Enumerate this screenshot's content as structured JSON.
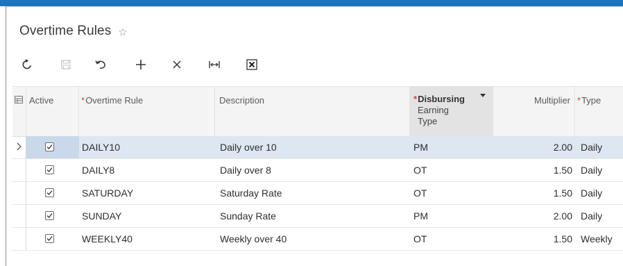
{
  "page": {
    "title": "Overtime Rules"
  },
  "toolbar": {
    "buttons": [
      {
        "icon": "refresh-icon",
        "enabled": true
      },
      {
        "icon": "save-icon",
        "enabled": false
      },
      {
        "icon": "undo-icon",
        "enabled": true
      },
      {
        "icon": "add-icon",
        "enabled": true
      },
      {
        "icon": "delete-icon",
        "enabled": true
      },
      {
        "icon": "fit-columns-icon",
        "enabled": true
      },
      {
        "icon": "export-excel-icon",
        "enabled": true
      }
    ]
  },
  "grid": {
    "headers": {
      "active": "Active",
      "overtime_rule": "Overtime Rule",
      "description": "Description",
      "disbursing_line1": "Disbursing",
      "disbursing_line2": "Earning",
      "disbursing_line3": "Type",
      "multiplier": "Multiplier",
      "type": "Type"
    },
    "required_marker": "*",
    "rows": [
      {
        "active": true,
        "rule": "DAILY10",
        "description": "Daily over 10",
        "earning_type": "PM",
        "multiplier": "2.00",
        "type": "Daily",
        "selected": true
      },
      {
        "active": true,
        "rule": "DAILY8",
        "description": "Daily over 8",
        "earning_type": "OT",
        "multiplier": "1.50",
        "type": "Daily",
        "selected": false
      },
      {
        "active": true,
        "rule": "SATURDAY",
        "description": "Saturday Rate",
        "earning_type": "OT",
        "multiplier": "1.50",
        "type": "Daily",
        "selected": false
      },
      {
        "active": true,
        "rule": "SUNDAY",
        "description": "Sunday Rate",
        "earning_type": "PM",
        "multiplier": "2.00",
        "type": "Daily",
        "selected": false
      },
      {
        "active": true,
        "rule": "WEEKLY40",
        "description": "Weekly over 40",
        "earning_type": "OT",
        "multiplier": "1.50",
        "type": "Weekly",
        "selected": false
      }
    ]
  },
  "colors": {
    "accent": "#1e73be",
    "required": "#e23b3b",
    "selected_row": "#dde7f1"
  }
}
